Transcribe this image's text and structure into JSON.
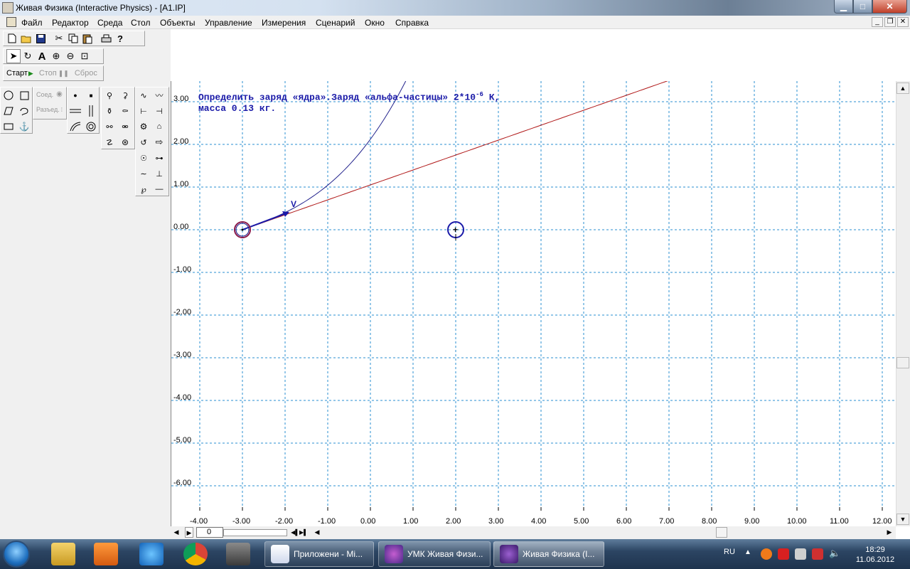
{
  "window": {
    "title": "Живая Физика (Interactive Physics) - [A1.IP]",
    "minimize_glyph": "▁",
    "maximize_glyph": "□",
    "close_glyph": "✕"
  },
  "menu": {
    "items": [
      "Файл",
      "Редактор",
      "Среда",
      "Стол",
      "Объекты",
      "Управление",
      "Измерения",
      "Сценарий",
      "Окно",
      "Справка"
    ],
    "mdi_min": "_",
    "mdi_restore": "❐",
    "mdi_close": "✕"
  },
  "run_controls": {
    "start_label": "Старт",
    "stop_label": "Стоп",
    "reset_label": "Сброс"
  },
  "palette": {
    "join_label": "Соед.",
    "split_label": "Разъед."
  },
  "canvas": {
    "problem_text_line1": "Определить заряд «ядра».Заряд «альфа-частицы» 2*10",
    "problem_exponent": "-6",
    "problem_text_unit": " К,",
    "problem_text_line2": "масса 0.13 кг.",
    "vector_label": "V",
    "charge_sign": "+",
    "x_ticks": [
      "-4.00",
      "-3.00",
      "-2.00",
      "-1.00",
      "0.00",
      "1.00",
      "2.00",
      "3.00",
      "4.00",
      "5.00",
      "6.00",
      "7.00",
      "8.00",
      "9.00",
      "10.00",
      "11.00",
      "12.00"
    ],
    "y_ticks": [
      "3.00",
      "2.00",
      "1.00",
      "0.00",
      "-1.00",
      "-2.00",
      "-3.00",
      "-4.00",
      "-5.00",
      "-6.00"
    ],
    "alpha_particle_position": [
      -3.0,
      0.0
    ],
    "nucleus_position": [
      2.0,
      0.0
    ],
    "grid_color": "#2a8fd0",
    "trajectory_colors": [
      "#22228c",
      "#b01818"
    ]
  },
  "frame_controls": {
    "frame_value": "0"
  },
  "taskbar": {
    "buttons": [
      "Приложени - Mi...",
      "УМК Живая Физи...",
      "Живая Физика (I..."
    ],
    "lang": "RU",
    "time": "18:29",
    "date": "11.06.2012"
  }
}
